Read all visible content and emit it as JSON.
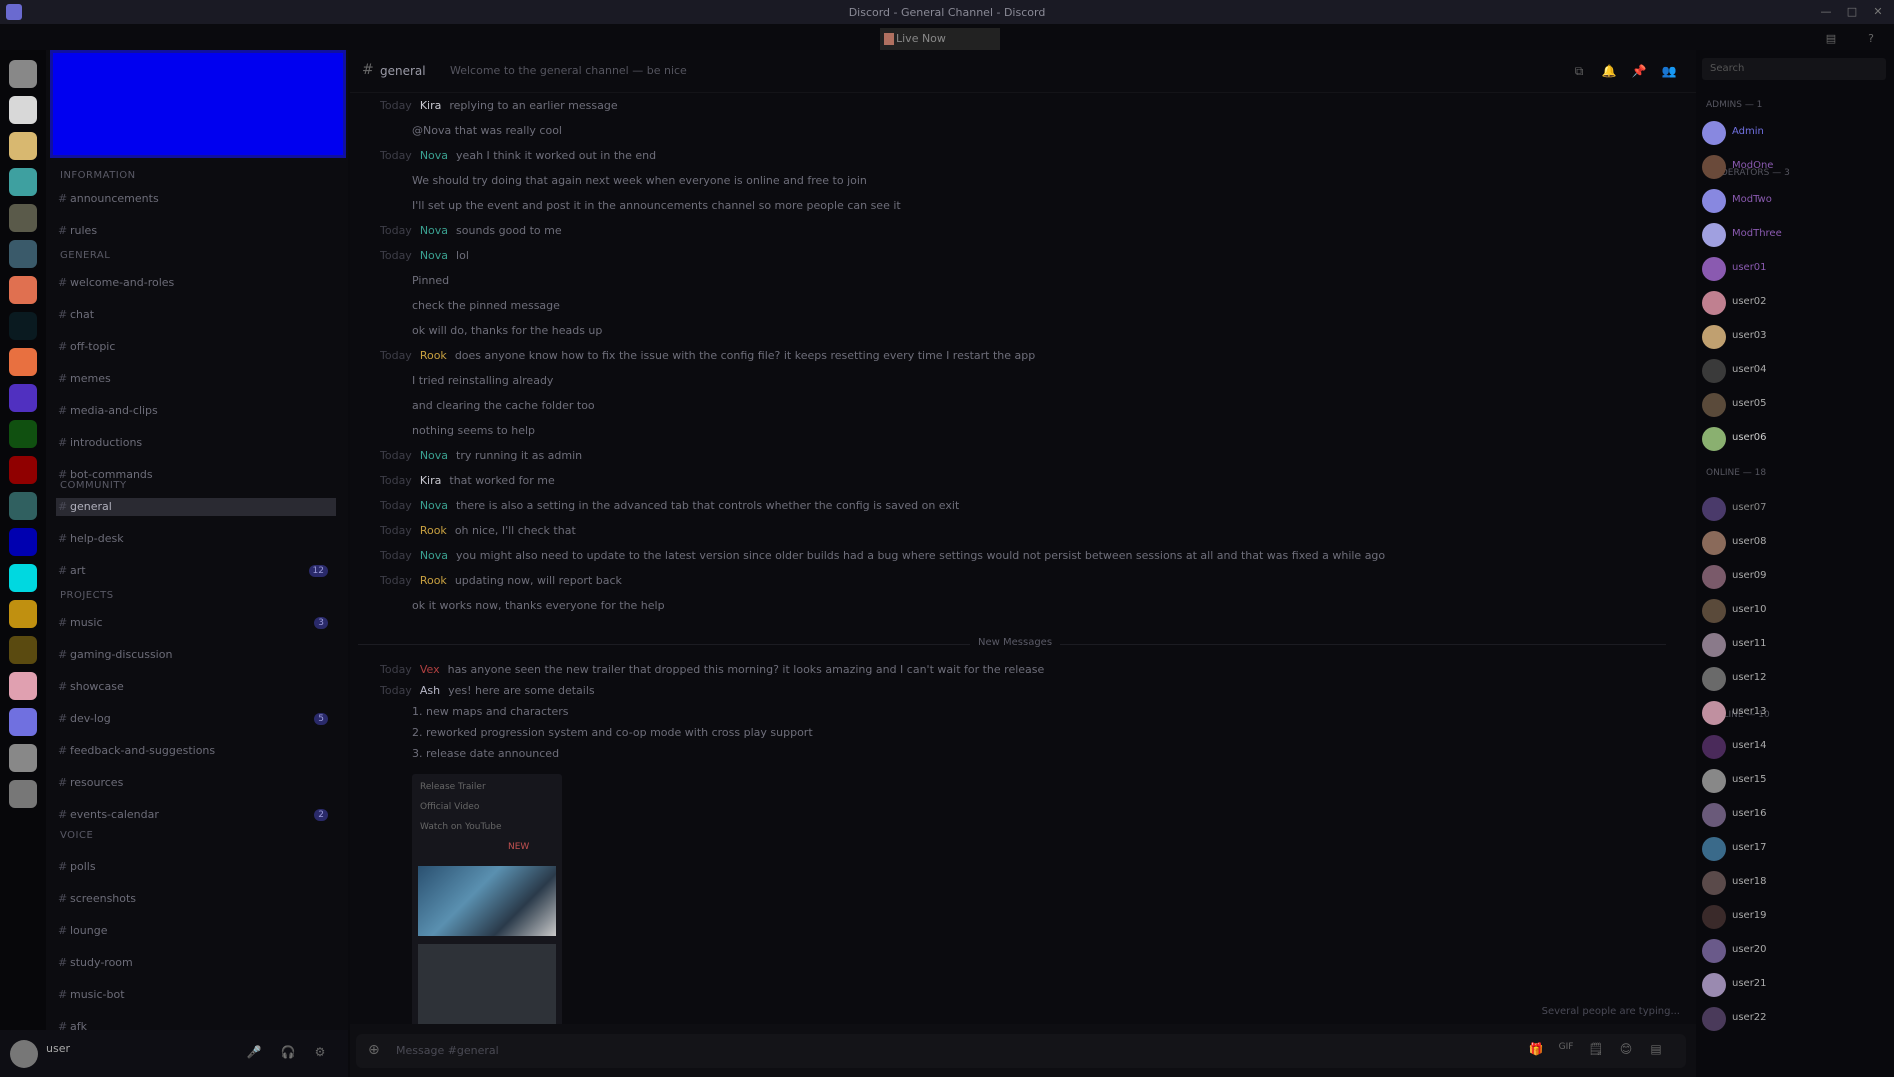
{
  "window": {
    "title": "Discord - General Channel - Discord",
    "controls": [
      "—",
      "□",
      "✕"
    ]
  },
  "notice": {
    "text": "Live Now"
  },
  "colors": {
    "accent": "#0000f0",
    "bg": "#0b0b0f"
  },
  "guilds": [
    {
      "name": "Home",
      "color": "#888888"
    },
    {
      "name": "Server A",
      "color": "#d8d8d8"
    },
    {
      "name": "Server B",
      "color": "#d8b870"
    },
    {
      "name": "Server C",
      "color": "#3ea0a0"
    },
    {
      "name": "Server D",
      "color": "#5a5a4a"
    },
    {
      "name": "Server E",
      "color": "#3a5a6a"
    },
    {
      "name": "Server F",
      "color": "#e07050"
    },
    {
      "name": "Server G",
      "color": "#0a1a20"
    },
    {
      "name": "Server H",
      "color": "#e87040"
    },
    {
      "name": "Server I",
      "color": "#5030c0"
    },
    {
      "name": "Server J",
      "color": "#105010"
    },
    {
      "name": "Server K",
      "color": "#900000"
    },
    {
      "name": "Server L",
      "color": "#306060"
    },
    {
      "name": "Server M",
      "color": "#0000b0"
    },
    {
      "name": "Server N",
      "color": "#00d8e0"
    },
    {
      "name": "Server O",
      "color": "#c09010"
    },
    {
      "name": "Server P",
      "color": "#5a4a10"
    },
    {
      "name": "Server Q",
      "color": "#e0a0b0"
    },
    {
      "name": "Server R",
      "color": "#7070e0"
    },
    {
      "name": "Server S",
      "color": "#888888"
    },
    {
      "name": "Server T",
      "color": "#777777"
    }
  ],
  "sidebar": {
    "categories": [
      {
        "label": "Information"
      },
      {
        "label": "General"
      },
      {
        "label": "Community"
      },
      {
        "label": "Projects"
      },
      {
        "label": "Voice"
      }
    ],
    "channels": [
      {
        "label": "announcements",
        "badge": ""
      },
      {
        "label": "rules",
        "badge": ""
      },
      {
        "label": "welcome-and-roles",
        "badge": ""
      },
      {
        "label": "chat",
        "badge": ""
      },
      {
        "label": "off-topic",
        "badge": ""
      },
      {
        "label": "memes",
        "badge": ""
      },
      {
        "label": "media-and-clips",
        "badge": ""
      },
      {
        "label": "introductions",
        "badge": ""
      },
      {
        "label": "bot-commands",
        "badge": ""
      },
      {
        "label": "general",
        "badge": ""
      },
      {
        "label": "help-desk",
        "badge": ""
      },
      {
        "label": "art",
        "badge": "12"
      },
      {
        "label": "music",
        "badge": "3"
      },
      {
        "label": "gaming-discussion",
        "badge": ""
      },
      {
        "label": "showcase",
        "badge": ""
      },
      {
        "label": "dev-log",
        "badge": "5"
      },
      {
        "label": "feedback-and-suggestions",
        "badge": ""
      },
      {
        "label": "resources",
        "badge": ""
      },
      {
        "label": "events-calendar",
        "badge": "2"
      },
      {
        "label": "polls",
        "badge": ""
      },
      {
        "label": "screenshots",
        "badge": ""
      },
      {
        "label": "lounge",
        "badge": ""
      },
      {
        "label": "study-room",
        "badge": ""
      },
      {
        "label": "music-bot",
        "badge": ""
      },
      {
        "label": "afk",
        "badge": ""
      }
    ]
  },
  "user": {
    "name": "user",
    "buttons": [
      "🎤",
      "🎧",
      "⚙"
    ]
  },
  "header": {
    "hash": "#",
    "channel": "general",
    "topic": "Welcome to the general channel — be nice",
    "buttons": [
      "⧉",
      "🔔",
      "📌",
      "👥"
    ]
  },
  "messages": [
    {
      "time": "Today",
      "author": "Kira",
      "authorColor": "#c8c8d0",
      "text": "replying to an earlier message"
    },
    {
      "time": "",
      "author": "",
      "authorColor": "#c8a040",
      "text": "@Nova that was really cool"
    },
    {
      "time": "Today",
      "author": "Nova",
      "authorColor": "#3aa090",
      "text": "yeah I think it worked out in the end"
    },
    {
      "time": "",
      "author": "",
      "authorColor": "#888",
      "text": "We should try doing that again next week when everyone is online and free to join"
    },
    {
      "time": "",
      "author": "",
      "authorColor": "#888",
      "text": "I'll set up the event and post it in the announcements channel so more people can see it"
    },
    {
      "time": "Today",
      "author": "Nova",
      "authorColor": "#3aa090",
      "text": "sounds good to me"
    },
    {
      "time": "Today",
      "author": "Nova",
      "authorColor": "#3aa090",
      "text": "lol"
    },
    {
      "time": "",
      "author": "",
      "authorColor": "#ddd",
      "text": "Pinned"
    },
    {
      "time": "",
      "author": "",
      "authorColor": "#888",
      "text": "check the pinned message"
    },
    {
      "time": "",
      "author": "",
      "authorColor": "#3aa090",
      "text": "ok will do, thanks for the heads up"
    },
    {
      "time": "Today",
      "author": "Rook",
      "authorColor": "#c8a040",
      "text": "does anyone know how to fix the issue with the config file? it keeps resetting every time I restart the app"
    },
    {
      "time": "",
      "author": "",
      "authorColor": "#c8a040",
      "text": "I tried reinstalling already"
    },
    {
      "time": "",
      "author": "",
      "authorColor": "#c8a040",
      "text": "and clearing the cache folder too"
    },
    {
      "time": "",
      "author": "",
      "authorColor": "#c8a040",
      "text": "nothing seems to help"
    },
    {
      "time": "Today",
      "author": "Nova",
      "authorColor": "#3aa090",
      "text": "try running it as admin"
    },
    {
      "time": "Today",
      "author": "Kira",
      "authorColor": "#c8c8d0",
      "text": "that worked for me"
    },
    {
      "time": "Today",
      "author": "Nova",
      "authorColor": "#3aa090",
      "text": "there is also a setting in the advanced tab that controls whether the config is saved on exit"
    },
    {
      "time": "Today",
      "author": "Rook",
      "authorColor": "#c8a040",
      "text": "oh nice, I'll check that"
    },
    {
      "time": "Today",
      "author": "Nova",
      "authorColor": "#3aa090",
      "text": "you might also need to update to the latest version since older builds had a bug where settings would not persist between sessions at all and that was fixed a while ago"
    },
    {
      "time": "Today",
      "author": "Rook",
      "authorColor": "#c8a040",
      "text": "updating now, will report back"
    },
    {
      "time": "",
      "author": "",
      "authorColor": "#c8a040",
      "text": "ok it works now, thanks everyone for the help"
    }
  ],
  "divider": {
    "label": "New Messages"
  },
  "messages2": [
    {
      "time": "Today",
      "author": "Vex",
      "authorColor": "#b04040",
      "text": "has anyone seen the new trailer that dropped this morning? it looks amazing and I can't wait for the release"
    },
    {
      "time": "Today",
      "author": "Ash",
      "authorColor": "#b8b8c8",
      "text": "yes! here are some details"
    },
    {
      "time": "",
      "author": "",
      "authorColor": "#b04040",
      "text": "1. new maps and characters"
    },
    {
      "time": "",
      "author": "",
      "authorColor": "#b04040",
      "text": "2. reworked progression system and co-op mode with cross play support"
    },
    {
      "time": "",
      "author": "",
      "authorColor": "#b04040",
      "text": "3. release date announced"
    }
  ],
  "embed": {
    "lines": [
      "Release Trailer",
      "Official Video",
      "Watch on YouTube"
    ],
    "tag": "NEW"
  },
  "composer": {
    "placeholder": "Message #general",
    "buttons": [
      "🎁",
      "GIF",
      "🗒",
      "😊",
      "▤"
    ]
  },
  "typing": "Several people are typing...",
  "membersPanel": {
    "search": "Search",
    "roles": [
      "Admins — 1",
      "Moderators — 3",
      "Online — 18",
      "Offline — 10"
    ],
    "members": [
      {
        "name": "Admin",
        "color": "#7070e0",
        "av": "#8888e0"
      },
      {
        "name": "ModOne",
        "color": "#8a5ab0",
        "av": "#6a4a3a"
      },
      {
        "name": "ModTwo",
        "color": "#8a5ab0",
        "av": "#8888e0"
      },
      {
        "name": "ModThree",
        "color": "#8a5ab0",
        "av": "#a0a0e0"
      },
      {
        "name": "user01",
        "color": "#8a5ab0",
        "av": "#8a5ab0"
      },
      {
        "name": "user02",
        "color": "#aaa",
        "av": "#c08090"
      },
      {
        "name": "user03",
        "color": "#aaa",
        "av": "#c0a070"
      },
      {
        "name": "user04",
        "color": "#aaa",
        "av": "#3a3a3a"
      },
      {
        "name": "user05",
        "color": "#aaa",
        "av": "#5a4a3a"
      },
      {
        "name": "user06",
        "color": "#ccc",
        "av": "#8ab070"
      },
      {
        "name": "user07",
        "color": "#888",
        "av": "#4a3a6a"
      },
      {
        "name": "user08",
        "color": "#aaa",
        "av": "#8a6a5a"
      },
      {
        "name": "user09",
        "color": "#aaa",
        "av": "#7a5a6a"
      },
      {
        "name": "user10",
        "color": "#aaa",
        "av": "#5a4a3a"
      },
      {
        "name": "user11",
        "color": "#aaa",
        "av": "#8a7a8a"
      },
      {
        "name": "user12",
        "color": "#aaa",
        "av": "#6a6a6a"
      },
      {
        "name": "user13",
        "color": "#aaa",
        "av": "#c090a0"
      },
      {
        "name": "user14",
        "color": "#aaa",
        "av": "#4a2a5a"
      },
      {
        "name": "user15",
        "color": "#aaa",
        "av": "#888"
      },
      {
        "name": "user16",
        "color": "#aaa",
        "av": "#6a5a7a"
      },
      {
        "name": "user17",
        "color": "#aaa",
        "av": "#3a6a8a"
      },
      {
        "name": "user18",
        "color": "#aaa",
        "av": "#5a4a4a"
      },
      {
        "name": "user19",
        "color": "#aaa",
        "av": "#3a2a2a"
      },
      {
        "name": "user20",
        "color": "#aaa",
        "av": "#6a5a8a"
      },
      {
        "name": "user21",
        "color": "#aaa",
        "av": "#9a8ab0"
      },
      {
        "name": "user22",
        "color": "#aaa",
        "av": "#4a3a5a"
      }
    ]
  }
}
